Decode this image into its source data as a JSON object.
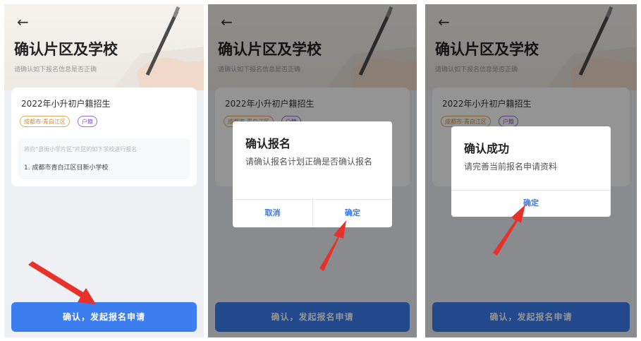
{
  "page": {
    "back_icon": "←",
    "title": "确认片区及学校",
    "subtitle": "请确认如下报名信息是否正确",
    "card": {
      "heading": "2022年小升初户籍招生",
      "tag_area": "成都市-青白江区",
      "tag_hukou": "户籍",
      "hint": "将向“县街小学片区”片区的如下学校进行报名",
      "school": "1. 成都市青白江区日新小学校"
    },
    "submit_label": "确认，发起报名申请"
  },
  "dialog_confirm": {
    "title": "确认报名",
    "message": "请确认报名计划正确是否确认报名",
    "cancel_label": "取消",
    "ok_label": "确定"
  },
  "dialog_success": {
    "title": "确认成功",
    "message": "请完善当前报名申请资料",
    "ok_label": "确定"
  },
  "colors": {
    "primary": "#3c7ef0",
    "arrow": "#e8312a",
    "tag_area": "#e3a95b",
    "tag_hukou": "#9b6bd9"
  }
}
